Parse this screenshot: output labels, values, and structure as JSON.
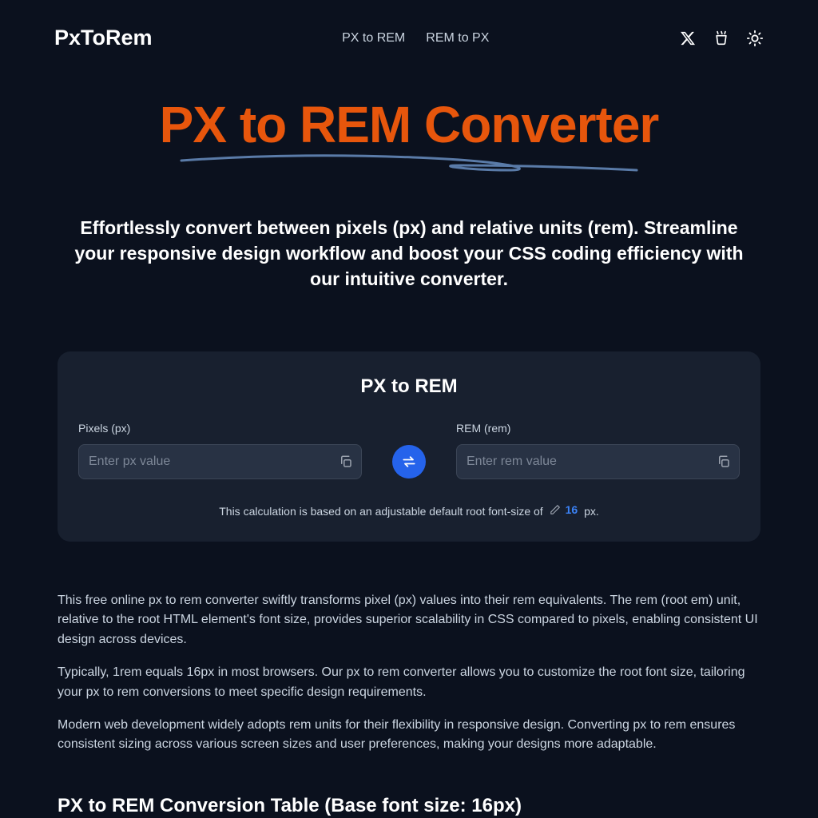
{
  "header": {
    "logo": "PxToRem",
    "nav": {
      "px_to_rem": "PX to REM",
      "rem_to_px": "REM to PX"
    }
  },
  "hero": {
    "title": "PX to REM Converter",
    "subtitle": "Effortlessly convert between pixels (px) and relative units (rem). Streamline your responsive design workflow and boost your CSS coding efficiency with our intuitive converter."
  },
  "card": {
    "title": "PX to REM",
    "px_label": "Pixels (px)",
    "px_placeholder": "Enter px value",
    "rem_label": "REM (rem)",
    "rem_placeholder": "Enter rem value",
    "footnote_prefix": "This calculation is based on an adjustable default root font-size of",
    "root_size": "16",
    "footnote_suffix": "px."
  },
  "content": {
    "p1": "This free online px to rem converter swiftly transforms pixel (px) values into their rem equivalents. The rem (root em) unit, relative to the root HTML element's font size, provides superior scalability in CSS compared to pixels, enabling consistent UI design across devices.",
    "p2": "Typically, 1rem equals 16px in most browsers. Our px to rem converter allows you to customize the root font size, tailoring your px to rem conversions to meet specific design requirements.",
    "p3": "Modern web development widely adopts rem units for their flexibility in responsive design. Converting px to rem ensures consistent sizing across various screen sizes and user preferences, making your designs more adaptable."
  },
  "table_heading": "PX to REM Conversion Table (Base font size: 16px)"
}
